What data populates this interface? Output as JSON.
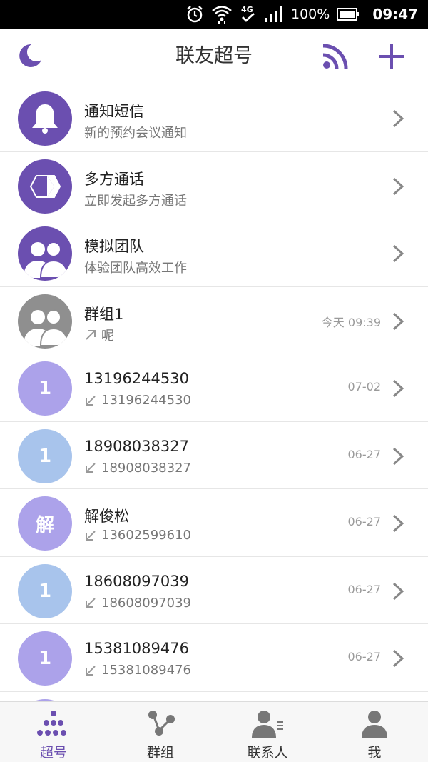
{
  "status_bar": {
    "network": "4G",
    "battery": "100%",
    "time": "09:47"
  },
  "header": {
    "title": "联友超号"
  },
  "list": [
    {
      "title": "通知短信",
      "subtitle": "新的预约会议通知",
      "time": "",
      "avatar": "bell-icon",
      "direction": ""
    },
    {
      "title": "多方通话",
      "subtitle": "立即发起多方通话",
      "time": "",
      "avatar": "cube-icon",
      "direction": ""
    },
    {
      "title": "模拟团队",
      "subtitle": "体验团队高效工作",
      "time": "",
      "avatar": "team-icon",
      "direction": ""
    },
    {
      "title": "群组1",
      "subtitle": "呢",
      "time": "今天 09:39",
      "avatar": "group-icon",
      "direction": "outgoing"
    },
    {
      "title": "13196244530",
      "subtitle": "13196244530",
      "time": "07-02",
      "avatar_text": "1",
      "direction": "incoming"
    },
    {
      "title": "18908038327",
      "subtitle": "18908038327",
      "time": "06-27",
      "avatar_text": "1",
      "direction": "incoming"
    },
    {
      "title": "解俊松",
      "subtitle": "13602599610",
      "time": "06-27",
      "avatar_text": "解",
      "direction": "incoming"
    },
    {
      "title": "18608097039",
      "subtitle": "18608097039",
      "time": "06-27",
      "avatar_text": "1",
      "direction": "incoming"
    },
    {
      "title": "15381089476",
      "subtitle": "15381089476",
      "time": "06-27",
      "avatar_text": "1",
      "direction": "incoming"
    }
  ],
  "bottom_nav": [
    {
      "label": "超号",
      "active": true
    },
    {
      "label": "群组",
      "active": false
    },
    {
      "label": "联系人",
      "active": false
    },
    {
      "label": "我",
      "active": false
    }
  ],
  "colors": {
    "accent": "#6b4fb0",
    "lavender": "#aca2ea",
    "light_blue": "#a8c4ec",
    "gray_avatar": "#8f8f8f",
    "status_bar": "#000000"
  }
}
